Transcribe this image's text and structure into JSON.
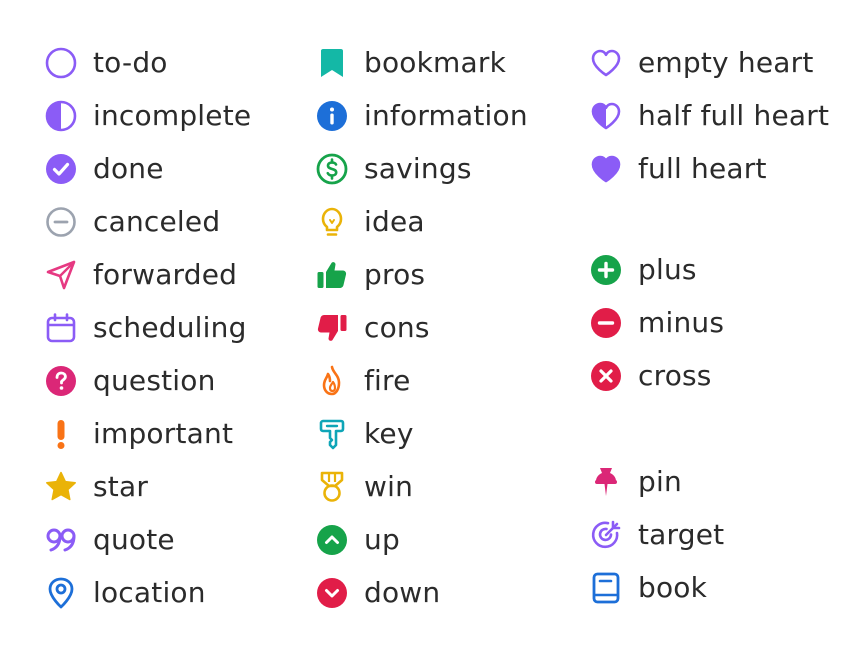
{
  "columns": {
    "one": {
      "items": [
        {
          "label": "to-do",
          "icon": "circle-outline-icon",
          "color": "#8b5cf6"
        },
        {
          "label": "incomplete",
          "icon": "half-circle-icon",
          "color": "#8b5cf6"
        },
        {
          "label": "done",
          "icon": "check-circle-icon",
          "color": "#8b5cf6"
        },
        {
          "label": "canceled",
          "icon": "minus-circle-outline-icon",
          "color": "#9ca3af"
        },
        {
          "label": "forwarded",
          "icon": "paper-plane-icon",
          "color": "#e63982"
        },
        {
          "label": "scheduling",
          "icon": "calendar-icon",
          "color": "#8b5cf6"
        },
        {
          "label": "question",
          "icon": "question-circle-icon",
          "color": "#db2777"
        },
        {
          "label": "important",
          "icon": "exclamation-icon",
          "color": "#f97316"
        },
        {
          "label": "star",
          "icon": "star-icon",
          "color": "#eab308"
        },
        {
          "label": "quote",
          "icon": "quote-icon",
          "color": "#8b5cf6"
        },
        {
          "label": "location",
          "icon": "location-pin-icon",
          "color": "#1d6fd8"
        }
      ]
    },
    "two": {
      "items": [
        {
          "label": "bookmark",
          "icon": "bookmark-icon",
          "color": "#14b8a6"
        },
        {
          "label": "information",
          "icon": "info-circle-icon",
          "color": "#1d6fd8"
        },
        {
          "label": "savings",
          "icon": "dollar-circle-icon",
          "color": "#16a34a"
        },
        {
          "label": "idea",
          "icon": "lightbulb-icon",
          "color": "#eab308"
        },
        {
          "label": "pros",
          "icon": "thumbs-up-icon",
          "color": "#16a34a"
        },
        {
          "label": "cons",
          "icon": "thumbs-down-icon",
          "color": "#e11d48"
        },
        {
          "label": "fire",
          "icon": "fire-icon",
          "color": "#f97316"
        },
        {
          "label": "key",
          "icon": "key-icon",
          "color": "#0ea5b7"
        },
        {
          "label": "win",
          "icon": "medal-icon",
          "color": "#eab308"
        },
        {
          "label": "up",
          "icon": "chevron-up-circle-icon",
          "color": "#16a34a"
        },
        {
          "label": "down",
          "icon": "chevron-down-circle-icon",
          "color": "#e11d48"
        }
      ]
    },
    "three": {
      "group1": [
        {
          "label": "empty heart",
          "icon": "heart-outline-icon",
          "color": "#8b5cf6"
        },
        {
          "label": "half full heart",
          "icon": "heart-half-icon",
          "color": "#8b5cf6"
        },
        {
          "label": "full heart",
          "icon": "heart-filled-icon",
          "color": "#8b5cf6"
        }
      ],
      "group2": [
        {
          "label": "plus",
          "icon": "plus-circle-icon",
          "color": "#16a34a"
        },
        {
          "label": "minus",
          "icon": "minus-circle-icon",
          "color": "#e11d48"
        },
        {
          "label": "cross",
          "icon": "cross-circle-icon",
          "color": "#e11d48"
        }
      ],
      "group3": [
        {
          "label": "pin",
          "icon": "pushpin-icon",
          "color": "#db2777"
        },
        {
          "label": "target",
          "icon": "target-icon",
          "color": "#8b5cf6"
        },
        {
          "label": "book",
          "icon": "book-icon",
          "color": "#1d6fd8"
        }
      ]
    }
  }
}
